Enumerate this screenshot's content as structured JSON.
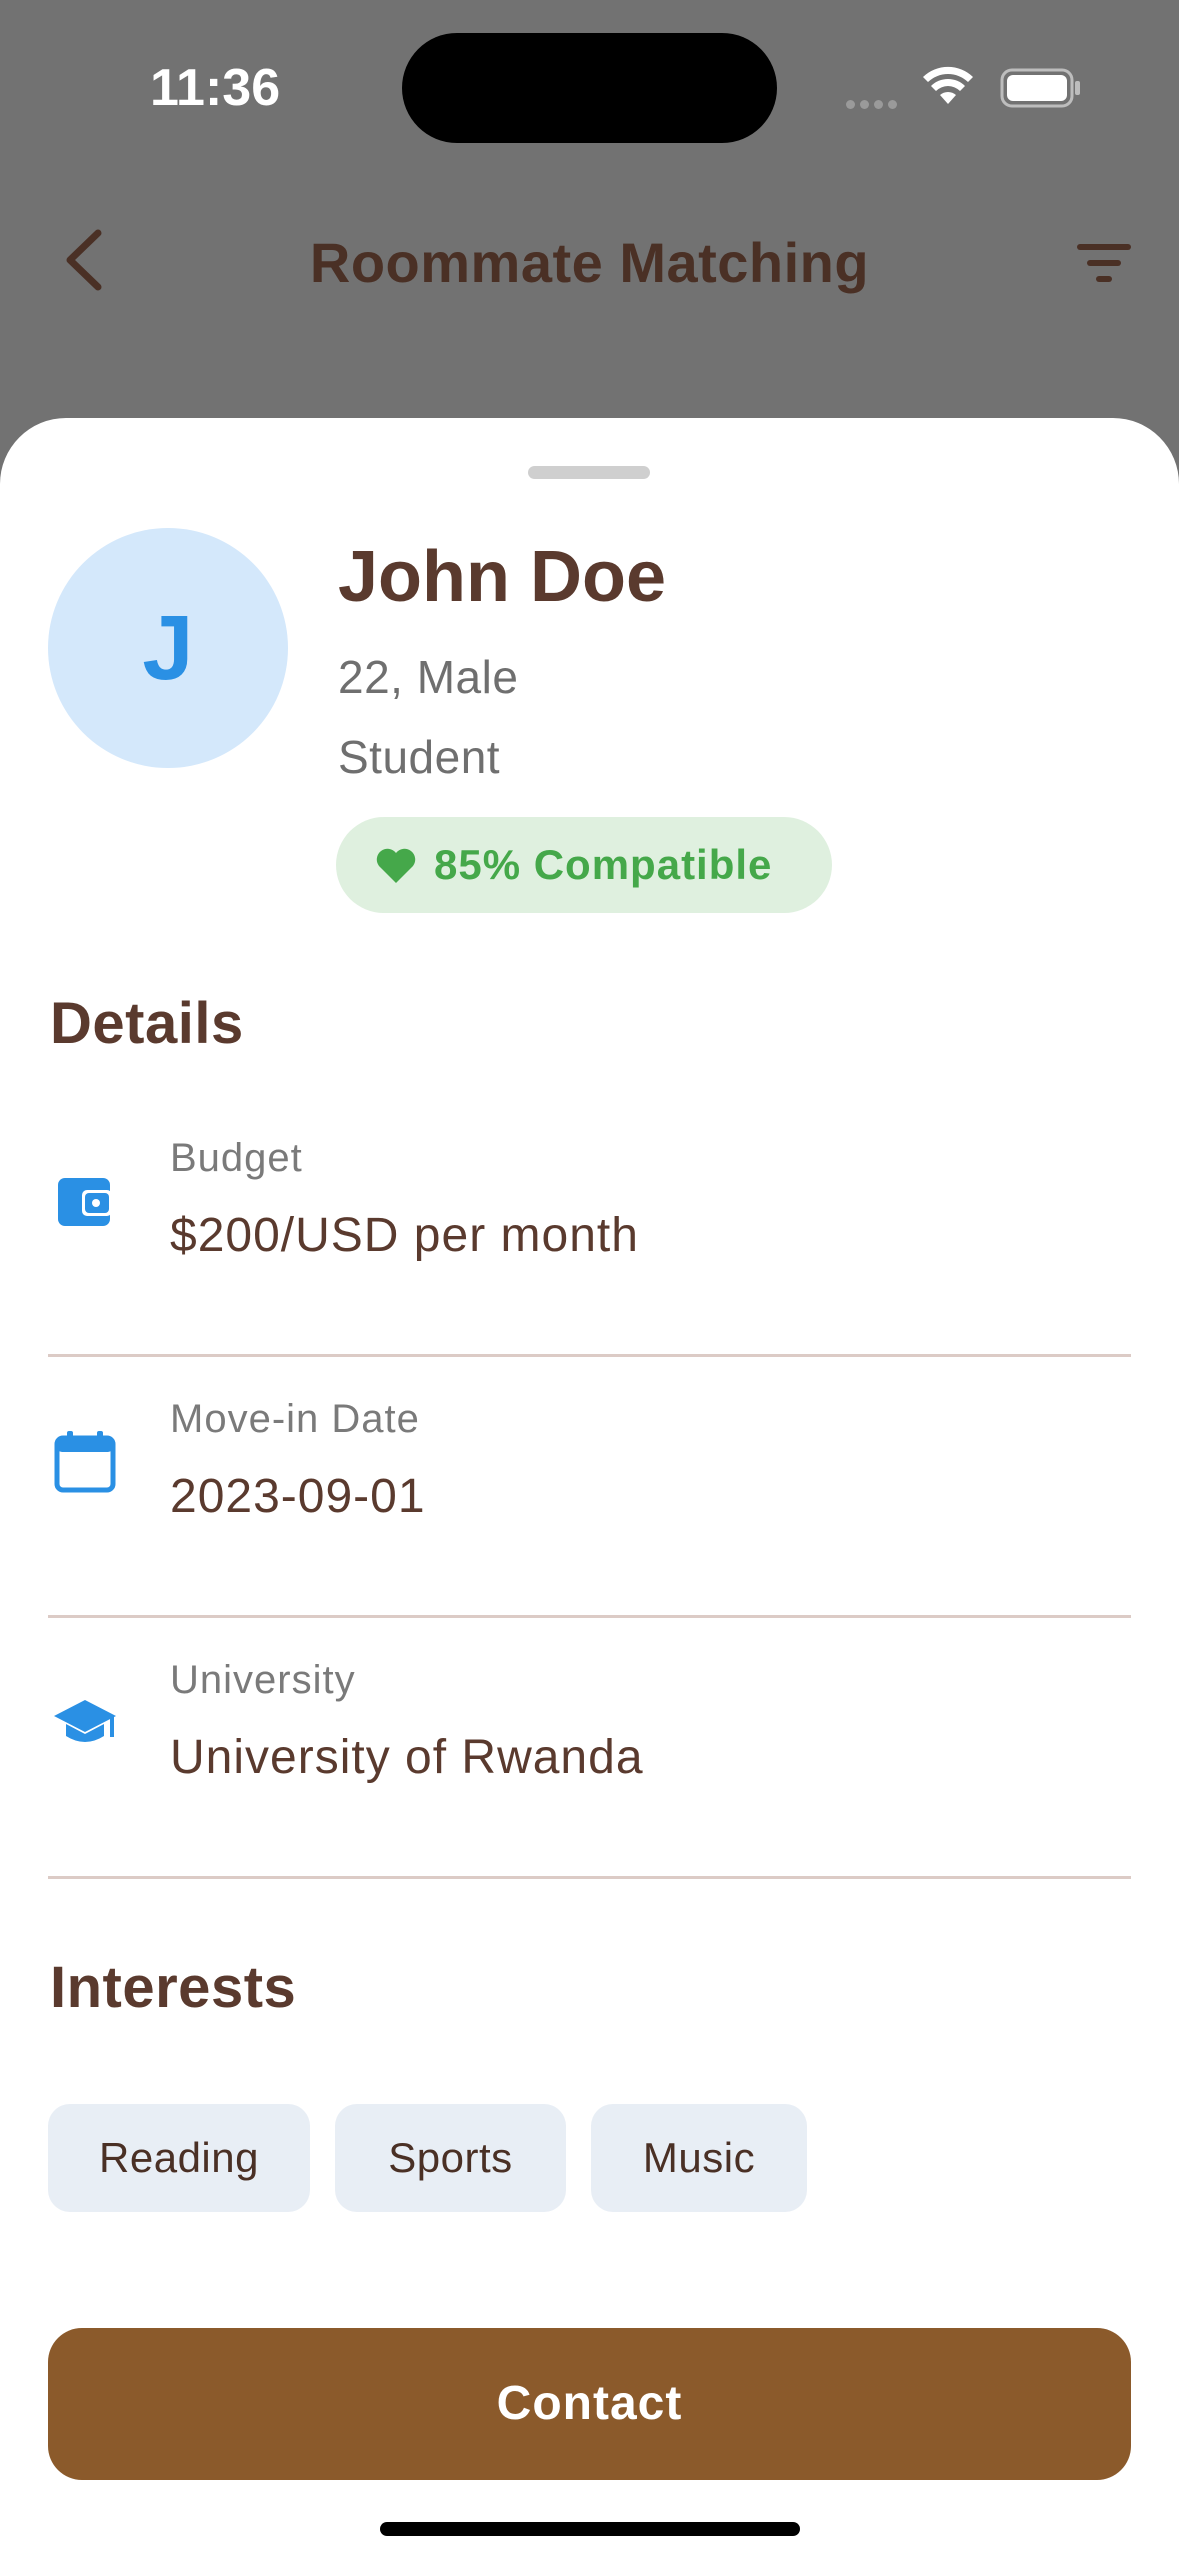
{
  "status_bar": {
    "time": "11:36"
  },
  "app_bar": {
    "title": "Roommate Matching"
  },
  "profile": {
    "initial": "J",
    "name": "John Doe",
    "age_gender": "22, Male",
    "occupation": "Student",
    "compatibility": "85% Compatible"
  },
  "details": {
    "title": "Details",
    "items": [
      {
        "icon": "wallet-icon",
        "label": "Budget",
        "value": "$200/USD per month"
      },
      {
        "icon": "calendar-icon",
        "label": "Move-in Date",
        "value": "2023-09-01"
      },
      {
        "icon": "school-icon",
        "label": "University",
        "value": "University of Rwanda"
      }
    ]
  },
  "interests": {
    "title": "Interests",
    "items": [
      "Reading",
      "Sports",
      "Music"
    ]
  },
  "actions": {
    "contact_label": "Contact"
  },
  "colors": {
    "accent_brown": "#8b5a2b",
    "text_brown": "#5a3a2e",
    "icon_blue": "#2a90e4",
    "compat_green": "#45a84a",
    "compat_bg": "#dff0df",
    "avatar_bg": "#d4e8fb",
    "chip_bg": "#e8eef5",
    "scrim": "#727272"
  }
}
